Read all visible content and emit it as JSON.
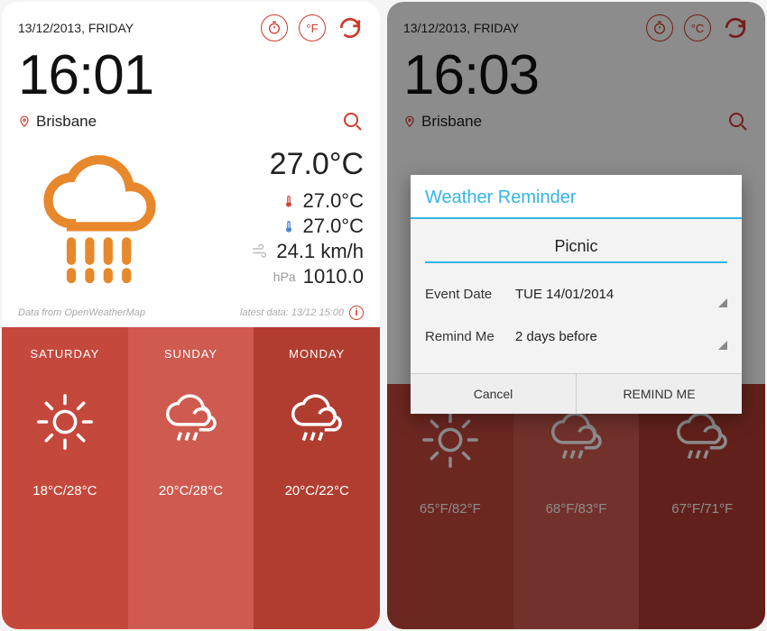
{
  "screen1": {
    "date": "13/12/2013, FRIDAY",
    "unit_toggle": "°F",
    "time": "16:01",
    "location": "Brisbane",
    "temp": "27.0°C",
    "hi": "27.0°C",
    "lo": "27.0°C",
    "wind": "24.1 km/h",
    "pressure_lbl": "hPa",
    "pressure": "1010.0",
    "source": "Data from OpenWeatherMap",
    "latest": "latest data: 13/12 15:00",
    "forecast": [
      {
        "day": "SATURDAY",
        "temps": "18°C/28°C"
      },
      {
        "day": "SUNDAY",
        "temps": "20°C/28°C"
      },
      {
        "day": "MONDAY",
        "temps": "20°C/22°C"
      }
    ]
  },
  "screen2": {
    "date": "13/12/2013, FRIDAY",
    "unit_toggle": "°C",
    "time": "16:03",
    "location": "Brisbane",
    "forecast": [
      {
        "day": "",
        "temps": "65°F/82°F"
      },
      {
        "day": "",
        "temps": "68°F/83°F"
      },
      {
        "day": "",
        "temps": "67°F/71°F"
      }
    ],
    "dialog": {
      "title": "Weather Reminder",
      "event": "Picnic",
      "row1_lbl": "Event Date",
      "row1_val": "TUE 14/01/2014",
      "row2_lbl": "Remind Me",
      "row2_val": "2 days before",
      "cancel": "Cancel",
      "ok": "REMIND ME"
    }
  },
  "colors": {
    "accent": "#cf3a2a",
    "orange": "#e8882c",
    "blue": "#33b5e5"
  }
}
